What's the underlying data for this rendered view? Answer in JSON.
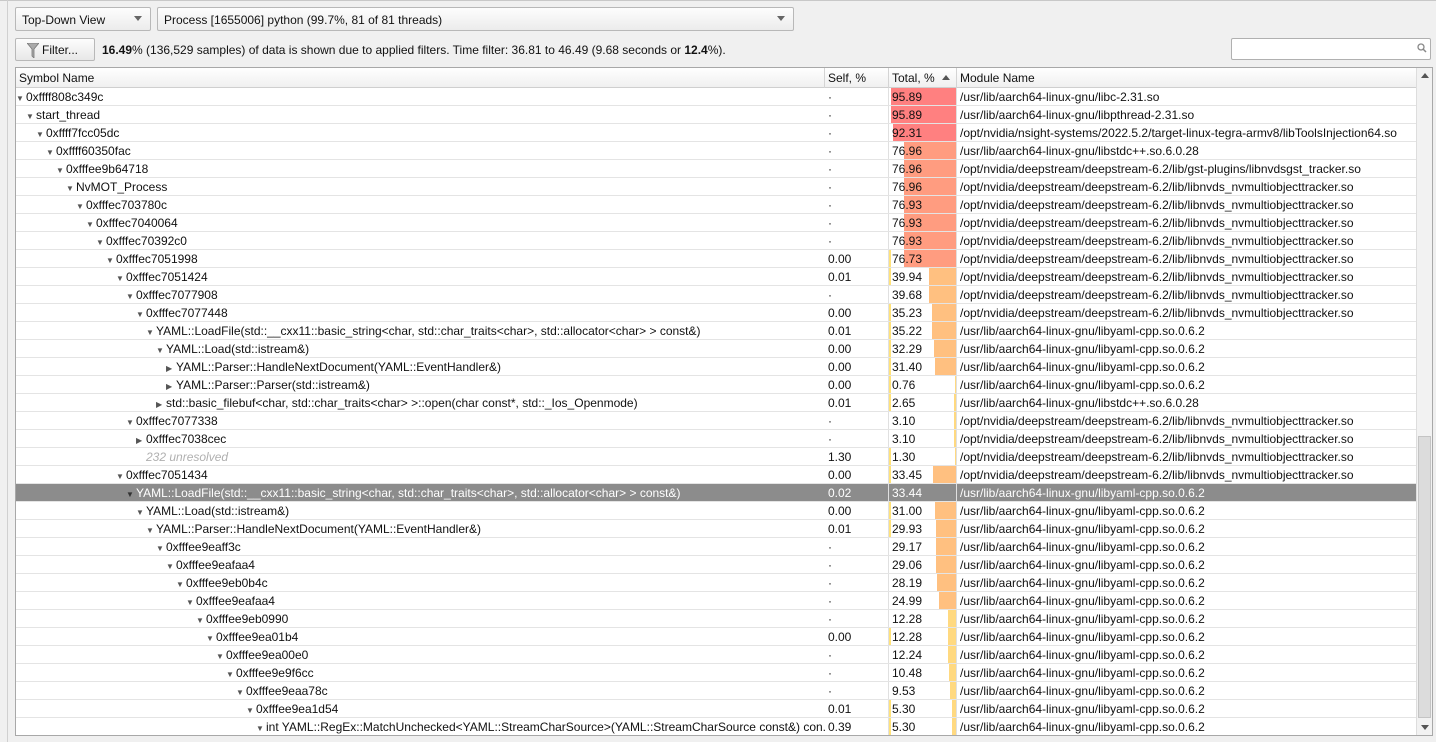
{
  "toolbar": {
    "view": "Top-Down View",
    "process": "Process [1655006] python (99.7%, 81 of 81 threads)",
    "filter_label": "Filter...",
    "search_value": ""
  },
  "filter_msg": {
    "pct": "16.49",
    "t1": "% (136,529 samples) of data is shown due to applied filters. Time filter: 36.81 to 46.49 (9.68 seconds or ",
    "pct2": "12.4",
    "t2": "%)."
  },
  "columns": {
    "symbol": "Symbol Name",
    "self": "Self, %",
    "total": "Total, %",
    "module": "Module Name"
  },
  "colors": {
    "high": "#ff8080",
    "upper": "#ff9c80",
    "mid": "#ffc080",
    "low": "#ffd980",
    "self": "#ffe27a",
    "selected": "#8c8c8c"
  },
  "rows": [
    {
      "sym": "0xffff808c349c",
      "lvl": 0,
      "st": "e",
      "self": "·",
      "total": "95.89",
      "mod": "/usr/lib/aarch64-linux-gnu/libc-2.31.so"
    },
    {
      "sym": "start_thread",
      "lvl": 1,
      "st": "e",
      "self": "·",
      "total": "95.89",
      "mod": "/usr/lib/aarch64-linux-gnu/libpthread-2.31.so"
    },
    {
      "sym": "0xffff7fcc05dc",
      "lvl": 2,
      "st": "e",
      "self": "·",
      "total": "92.31",
      "mod": "/opt/nvidia/nsight-systems/2022.5.2/target-linux-tegra-armv8/libToolsInjection64.so"
    },
    {
      "sym": "0xffff60350fac",
      "lvl": 3,
      "st": "e",
      "self": "·",
      "total": "76.96",
      "mod": "/usr/lib/aarch64-linux-gnu/libstdc++.so.6.0.28"
    },
    {
      "sym": "0xfffee9b64718",
      "lvl": 4,
      "st": "e",
      "self": "·",
      "total": "76.96",
      "mod": "/opt/nvidia/deepstream/deepstream-6.2/lib/gst-plugins/libnvdsgst_tracker.so"
    },
    {
      "sym": "NvMOT_Process",
      "lvl": 5,
      "st": "e",
      "self": "·",
      "total": "76.96",
      "mod": "/opt/nvidia/deepstream/deepstream-6.2/lib/libnvds_nvmultiobjecttracker.so"
    },
    {
      "sym": "0xfffec703780c",
      "lvl": 6,
      "st": "e",
      "self": "·",
      "total": "76.93",
      "mod": "/opt/nvidia/deepstream/deepstream-6.2/lib/libnvds_nvmultiobjecttracker.so"
    },
    {
      "sym": "0xfffec7040064",
      "lvl": 7,
      "st": "e",
      "self": "·",
      "total": "76.93",
      "mod": "/opt/nvidia/deepstream/deepstream-6.2/lib/libnvds_nvmultiobjecttracker.so"
    },
    {
      "sym": "0xfffec70392c0",
      "lvl": 8,
      "st": "e",
      "self": "·",
      "total": "76.93",
      "mod": "/opt/nvidia/deepstream/deepstream-6.2/lib/libnvds_nvmultiobjecttracker.so"
    },
    {
      "sym": "0xfffec7051998",
      "lvl": 9,
      "st": "e",
      "self": "0.00",
      "total": "76.73",
      "mod": "/opt/nvidia/deepstream/deepstream-6.2/lib/libnvds_nvmultiobjecttracker.so"
    },
    {
      "sym": "0xfffec7051424",
      "lvl": 10,
      "st": "e",
      "self": "0.01",
      "total": "39.94",
      "mod": "/opt/nvidia/deepstream/deepstream-6.2/lib/libnvds_nvmultiobjecttracker.so"
    },
    {
      "sym": "0xfffec7077908",
      "lvl": 11,
      "st": "e",
      "self": "·",
      "total": "39.68",
      "mod": "/opt/nvidia/deepstream/deepstream-6.2/lib/libnvds_nvmultiobjecttracker.so"
    },
    {
      "sym": "0xfffec7077448",
      "lvl": 12,
      "st": "e",
      "self": "0.00",
      "total": "35.23",
      "mod": "/opt/nvidia/deepstream/deepstream-6.2/lib/libnvds_nvmultiobjecttracker.so"
    },
    {
      "sym": "YAML::LoadFile(std::__cxx11::basic_string<char, std::char_traits<char>, std::allocator<char> > const&)",
      "lvl": 13,
      "st": "e",
      "self": "0.01",
      "total": "35.22",
      "mod": "/usr/lib/aarch64-linux-gnu/libyaml-cpp.so.0.6.2"
    },
    {
      "sym": "YAML::Load(std::istream&)",
      "lvl": 14,
      "st": "e",
      "self": "0.00",
      "total": "32.29",
      "mod": "/usr/lib/aarch64-linux-gnu/libyaml-cpp.so.0.6.2"
    },
    {
      "sym": "YAML::Parser::HandleNextDocument(YAML::EventHandler&)",
      "lvl": 15,
      "st": "c",
      "self": "0.00",
      "total": "31.40",
      "mod": "/usr/lib/aarch64-linux-gnu/libyaml-cpp.so.0.6.2"
    },
    {
      "sym": "YAML::Parser::Parser(std::istream&)",
      "lvl": 15,
      "st": "c",
      "self": "0.00",
      "total": "0.76",
      "mod": "/usr/lib/aarch64-linux-gnu/libyaml-cpp.so.0.6.2"
    },
    {
      "sym": "std::basic_filebuf<char, std::char_traits<char> >::open(char const*, std::_Ios_Openmode)",
      "lvl": 14,
      "st": "c",
      "self": "0.01",
      "total": "2.65",
      "mod": "/usr/lib/aarch64-linux-gnu/libstdc++.so.6.0.28"
    },
    {
      "sym": "0xfffec7077338",
      "lvl": 11,
      "st": "e",
      "self": "·",
      "total": "3.10",
      "mod": "/opt/nvidia/deepstream/deepstream-6.2/lib/libnvds_nvmultiobjecttracker.so"
    },
    {
      "sym": "0xfffec7038cec",
      "lvl": 12,
      "st": "c",
      "self": "·",
      "total": "3.10",
      "mod": "/opt/nvidia/deepstream/deepstream-6.2/lib/libnvds_nvmultiobjecttracker.so"
    },
    {
      "sym": "232 unresolved",
      "lvl": 12,
      "st": "n",
      "self": "1.30",
      "total": "1.30",
      "mod": "/opt/nvidia/deepstream/deepstream-6.2/lib/libnvds_nvmultiobjecttracker.so"
    },
    {
      "sym": "0xfffec7051434",
      "lvl": 10,
      "st": "e",
      "self": "0.00",
      "total": "33.45",
      "mod": "/opt/nvidia/deepstream/deepstream-6.2/lib/libnvds_nvmultiobjecttracker.so"
    },
    {
      "sym": "YAML::LoadFile(std::__cxx11::basic_string<char, std::char_traits<char>, std::allocator<char> > const&)",
      "lvl": 11,
      "st": "e",
      "self": "0.02",
      "total": "33.44",
      "mod": "/usr/lib/aarch64-linux-gnu/libyaml-cpp.so.0.6.2",
      "selected": true
    },
    {
      "sym": "YAML::Load(std::istream&)",
      "lvl": 12,
      "st": "e",
      "self": "0.00",
      "total": "31.00",
      "mod": "/usr/lib/aarch64-linux-gnu/libyaml-cpp.so.0.6.2"
    },
    {
      "sym": "YAML::Parser::HandleNextDocument(YAML::EventHandler&)",
      "lvl": 13,
      "st": "e",
      "self": "0.01",
      "total": "29.93",
      "mod": "/usr/lib/aarch64-linux-gnu/libyaml-cpp.so.0.6.2"
    },
    {
      "sym": "0xfffee9eaff3c",
      "lvl": 14,
      "st": "e",
      "self": "·",
      "total": "29.17",
      "mod": "/usr/lib/aarch64-linux-gnu/libyaml-cpp.so.0.6.2"
    },
    {
      "sym": "0xfffee9eafaa4",
      "lvl": 15,
      "st": "e",
      "self": "·",
      "total": "29.06",
      "mod": "/usr/lib/aarch64-linux-gnu/libyaml-cpp.so.0.6.2"
    },
    {
      "sym": "0xfffee9eb0b4c",
      "lvl": 16,
      "st": "e",
      "self": "·",
      "total": "28.19",
      "mod": "/usr/lib/aarch64-linux-gnu/libyaml-cpp.so.0.6.2"
    },
    {
      "sym": "0xfffee9eafaa4",
      "lvl": 17,
      "st": "e",
      "self": "·",
      "total": "24.99",
      "mod": "/usr/lib/aarch64-linux-gnu/libyaml-cpp.so.0.6.2"
    },
    {
      "sym": "0xfffee9eb0990",
      "lvl": 18,
      "st": "e",
      "self": "·",
      "total": "12.28",
      "mod": "/usr/lib/aarch64-linux-gnu/libyaml-cpp.so.0.6.2"
    },
    {
      "sym": "0xfffee9ea01b4",
      "lvl": 19,
      "st": "e",
      "self": "0.00",
      "total": "12.28",
      "mod": "/usr/lib/aarch64-linux-gnu/libyaml-cpp.so.0.6.2"
    },
    {
      "sym": "0xfffee9ea00e0",
      "lvl": 20,
      "st": "e",
      "self": "·",
      "total": "12.24",
      "mod": "/usr/lib/aarch64-linux-gnu/libyaml-cpp.so.0.6.2"
    },
    {
      "sym": "0xfffee9e9f6cc",
      "lvl": 21,
      "st": "e",
      "self": "·",
      "total": "10.48",
      "mod": "/usr/lib/aarch64-linux-gnu/libyaml-cpp.so.0.6.2"
    },
    {
      "sym": "0xfffee9eaa78c",
      "lvl": 22,
      "st": "e",
      "self": "·",
      "total": "9.53",
      "mod": "/usr/lib/aarch64-linux-gnu/libyaml-cpp.so.0.6.2"
    },
    {
      "sym": "0xfffee9ea1d54",
      "lvl": 23,
      "st": "e",
      "self": "0.01",
      "total": "5.30",
      "mod": "/usr/lib/aarch64-linux-gnu/libyaml-cpp.so.0.6.2"
    },
    {
      "sym": "int YAML::RegEx::MatchUnchecked<YAML::StreamCharSource>(YAML::StreamCharSource const&) con...",
      "lvl": 24,
      "st": "e",
      "self": "0.39",
      "total": "5.30",
      "mod": "/usr/lib/aarch64-linux-gnu/libyaml-cpp.so.0.6.2"
    }
  ]
}
